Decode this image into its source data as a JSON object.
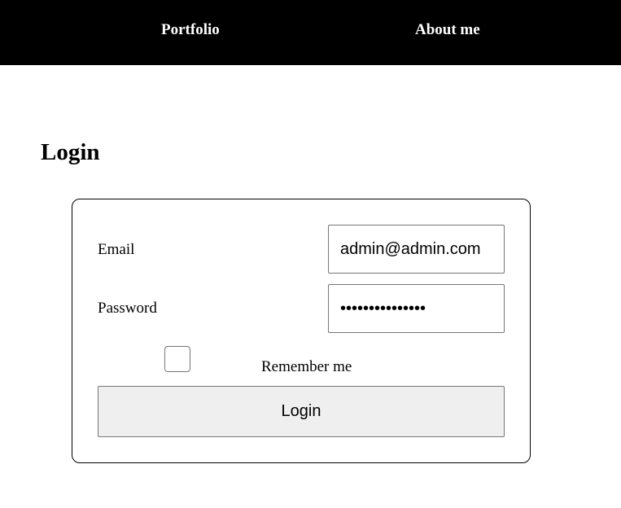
{
  "nav": {
    "links": [
      {
        "label": "Portfolio"
      },
      {
        "label": "About me"
      }
    ]
  },
  "page": {
    "title": "Login"
  },
  "form": {
    "email": {
      "label": "Email",
      "value": "admin@admin.com"
    },
    "password": {
      "label": "Password",
      "value": "•••••••••••••••"
    },
    "remember": {
      "label": "Remember me",
      "checked": false
    },
    "submit_label": "Login"
  },
  "colors": {
    "navbar_bg": "#000000",
    "nav_text": "#ffffff",
    "button_bg": "#efefef",
    "input_border": "#767676"
  }
}
